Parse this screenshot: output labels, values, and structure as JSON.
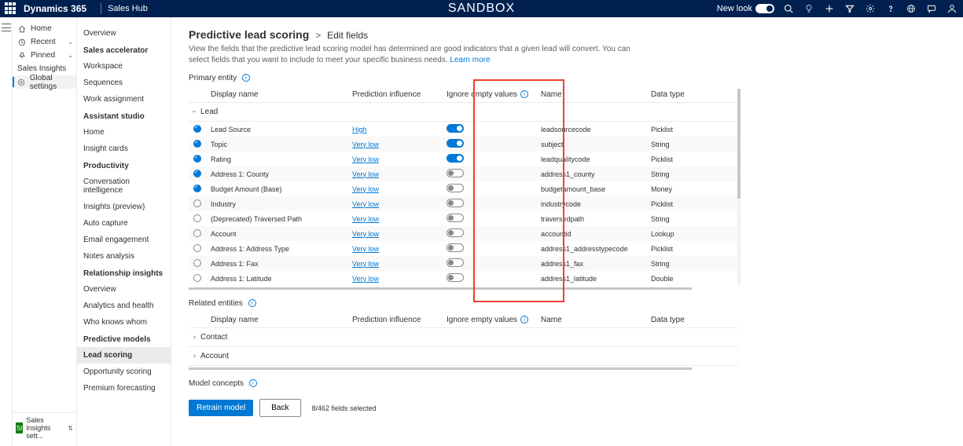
{
  "topbar": {
    "brand": "Dynamics 365",
    "app": "Sales Hub",
    "center": "SANDBOX",
    "newlook": "New look"
  },
  "nav": {
    "home": "Home",
    "recent": "Recent",
    "pinned": "Pinned",
    "section": "Sales Insights",
    "global": "Global settings",
    "footer": "Sales Insights sett..."
  },
  "side": {
    "overview": "Overview",
    "g1": "Sales accelerator",
    "workspace": "Workspace",
    "sequences": "Sequences",
    "work": "Work assignment",
    "g2": "Assistant studio",
    "home2": "Home",
    "cards": "Insight cards",
    "g3": "Productivity",
    "ci": "Conversation intelligence",
    "ip": "Insights (preview)",
    "ac": "Auto capture",
    "ee": "Email engagement",
    "na": "Notes analysis",
    "g4": "Relationship insights",
    "ov2": "Overview",
    "ah": "Analytics and health",
    "wkw": "Who knows whom",
    "g5": "Predictive models",
    "ls": "Lead scoring",
    "os": "Opportunity scoring",
    "pf": "Premium forecasting"
  },
  "page": {
    "title": "Predictive lead scoring",
    "sub": "Edit fields",
    "desc": "View the fields that the predictive lead scoring model has determined are good indicators that a given lead will convert. You can select fields that you want to include to meet your specific business needs. ",
    "learn": "Learn more",
    "primary": "Primary entity",
    "related": "Related entities",
    "concepts": "Model concepts",
    "retrain": "Retrain model",
    "back": "Back",
    "count": "8/462 fields selected"
  },
  "cols": {
    "dn": "Display name",
    "pi": "Prediction influence",
    "iev": "Ignore empty values",
    "name": "Name",
    "dt": "Data type"
  },
  "groups": {
    "lead": "Lead",
    "contact": "Contact",
    "account": "Account"
  },
  "rows": [
    {
      "sel": true,
      "dn": "Lead Source",
      "pi": "High",
      "tog": true,
      "name": "leadsourcecode",
      "dt": "Picklist"
    },
    {
      "sel": true,
      "dn": "Topic",
      "pi": "Very low",
      "tog": true,
      "name": "subject",
      "dt": "String"
    },
    {
      "sel": true,
      "dn": "Rating",
      "pi": "Very low",
      "tog": true,
      "name": "leadqualitycode",
      "dt": "Picklist"
    },
    {
      "sel": true,
      "dn": "Address 1: County",
      "pi": "Very low",
      "tog": false,
      "name": "address1_county",
      "dt": "String"
    },
    {
      "sel": true,
      "dn": "Budget Amount (Base)",
      "pi": "Very low",
      "tog": false,
      "name": "budgetamount_base",
      "dt": "Money"
    },
    {
      "sel": false,
      "dn": "Industry",
      "pi": "Very low",
      "tog": false,
      "name": "industrycode",
      "dt": "Picklist"
    },
    {
      "sel": false,
      "dn": "(Deprecated) Traversed Path",
      "pi": "Very low",
      "tog": false,
      "name": "traversedpath",
      "dt": "String"
    },
    {
      "sel": false,
      "dn": "Account",
      "pi": "Very low",
      "tog": false,
      "name": "accountid",
      "dt": "Lookup"
    },
    {
      "sel": false,
      "dn": "Address 1: Address Type",
      "pi": "Very low",
      "tog": false,
      "name": "address1_addresstypecode",
      "dt": "Picklist"
    },
    {
      "sel": false,
      "dn": "Address 1: Fax",
      "pi": "Very low",
      "tog": false,
      "name": "address1_fax",
      "dt": "String"
    },
    {
      "sel": false,
      "dn": "Address 1: Latitude",
      "pi": "Very low",
      "tog": false,
      "name": "address1_latitude",
      "dt": "Double"
    }
  ]
}
